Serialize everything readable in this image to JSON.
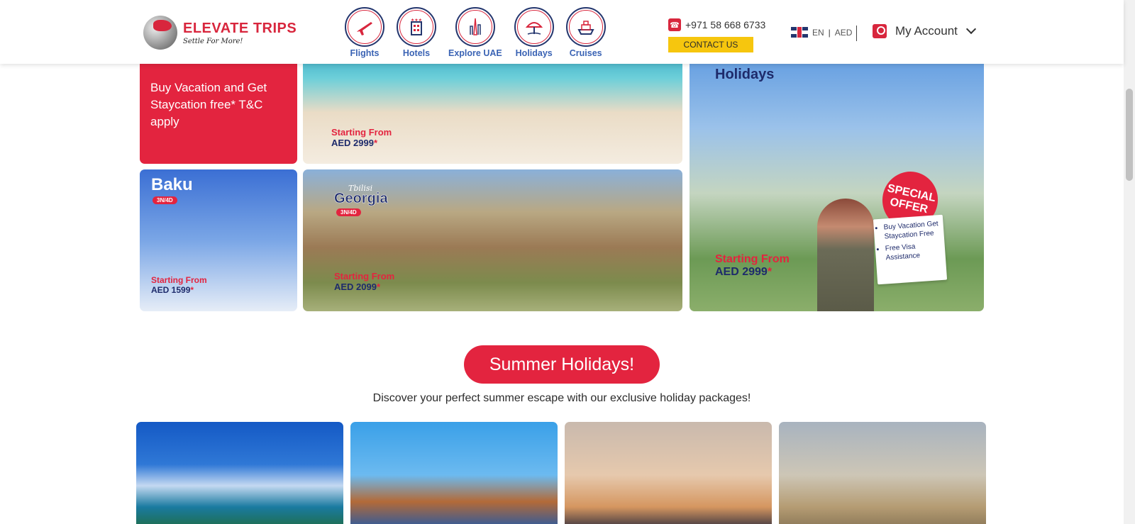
{
  "brand": {
    "name": "ELEVATE TRIPS",
    "tagline": "Settle For More!"
  },
  "nav": {
    "items": [
      {
        "label": "Flights",
        "icon": "plane-icon"
      },
      {
        "label": "Hotels",
        "icon": "hotel-icon"
      },
      {
        "label": "Explore UAE",
        "icon": "burj-icon"
      },
      {
        "label": "Holidays",
        "icon": "beach-umbrella-icon"
      },
      {
        "label": "Cruises",
        "icon": "cruise-ship-icon"
      }
    ]
  },
  "contact": {
    "phone": "+971 58 668 6733",
    "button_label": "CONTACT US"
  },
  "locale": {
    "language": "EN",
    "separator": "|",
    "currency": "AED"
  },
  "account": {
    "label": "My Account"
  },
  "promos": {
    "red_card_text": "Buy Vacation and Get Staycation free* T&C apply",
    "beach": {
      "starting_label": "Starting From",
      "price": "AED 2999",
      "asterisk": "*"
    },
    "baku": {
      "title": "Baku",
      "badge": "3N/4D",
      "starting_label": "Starting From",
      "price": "AED 1599",
      "asterisk": "*"
    },
    "georgia": {
      "script_title": "Tbilisi",
      "title": "Georgia",
      "badge": "3N/4D",
      "starting_label": "Starting From",
      "price": "AED 2099",
      "asterisk": "*"
    },
    "madrid": {
      "title": "Holidays",
      "offer_line1": "SPECIAL",
      "offer_line2": "OFFER",
      "bullets": [
        "Buy Vacation Get Staycation Free",
        "Free Visa Assistance"
      ],
      "starting_label": "Starting From",
      "price": "AED 2999",
      "asterisk": "*"
    }
  },
  "summer": {
    "button_label": "Summer Holidays!",
    "subtitle": "Discover your perfect summer escape with our exclusive holiday packages!"
  },
  "colors": {
    "brand_red": "#e3243f",
    "brand_navy": "#1e2b6b",
    "contact_yellow": "#f6c60e",
    "nav_blue": "#3a63b4"
  }
}
